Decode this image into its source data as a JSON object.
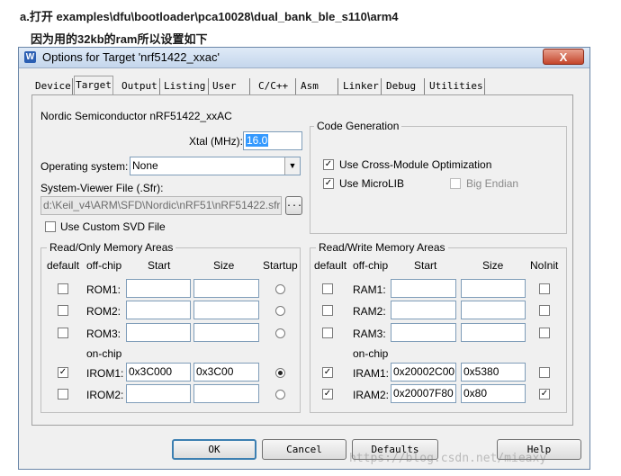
{
  "header": {
    "line1": "a.打开 examples\\dfu\\bootloader\\pca10028\\dual_bank_ble_s110\\arm4",
    "line2": "因为用的32kb的ram所以设置如下"
  },
  "dialog": {
    "icon": "W",
    "title": "Options for Target 'nrf51422_xxac'",
    "close": "X"
  },
  "tabs": [
    "Device",
    "Target",
    "Output",
    "Listing",
    "User",
    "C/C++",
    "Asm",
    "Linker",
    "Debug",
    "Utilities"
  ],
  "selected_tab": "Target",
  "target": {
    "device": "Nordic Semiconductor nRF51422_xxAC",
    "xtal_label": "Xtal (MHz):",
    "xtal_value": "16.0",
    "os_label": "Operating system:",
    "os_value": "None",
    "sv_label": "System-Viewer File (.Sfr):",
    "sv_value": "d:\\Keil_v4\\ARM\\SFD\\Nordic\\nRF51\\nRF51422.sfr",
    "browse": "...",
    "custom_svd": "Use Custom SVD File"
  },
  "codegen": {
    "title": "Code Generation",
    "cross_module": "Use Cross-Module Optimization",
    "microlib": "Use MicroLIB",
    "big_endian": "Big Endian"
  },
  "rom": {
    "title": "Read/Only Memory Areas",
    "col_default": "default",
    "col_offchip": "off-chip",
    "col_start": "Start",
    "col_size": "Size",
    "col_startup": "Startup",
    "onchip": "on-chip",
    "rows": [
      {
        "name": "ROM1:",
        "start": "",
        "size": ""
      },
      {
        "name": "ROM2:",
        "start": "",
        "size": ""
      },
      {
        "name": "ROM3:",
        "start": "",
        "size": ""
      },
      {
        "name": "IROM1:",
        "start": "0x3C000",
        "size": "0x3C00"
      },
      {
        "name": "IROM2:",
        "start": "",
        "size": ""
      }
    ]
  },
  "ram": {
    "title": "Read/Write Memory Areas",
    "col_default": "default",
    "col_offchip": "off-chip",
    "col_start": "Start",
    "col_size": "Size",
    "col_noinit": "NoInit",
    "onchip": "on-chip",
    "rows": [
      {
        "name": "RAM1:",
        "start": "",
        "size": ""
      },
      {
        "name": "RAM2:",
        "start": "",
        "size": ""
      },
      {
        "name": "RAM3:",
        "start": "",
        "size": ""
      },
      {
        "name": "IRAM1:",
        "start": "0x20002C00",
        "size": "0x5380"
      },
      {
        "name": "IRAM2:",
        "start": "0x20007F80",
        "size": "0x80"
      }
    ]
  },
  "buttons": {
    "ok": "OK",
    "cancel": "Cancel",
    "defaults": "Defaults",
    "help": "Help"
  },
  "watermark": "https://blog.csdn.net/mieaxy",
  "check": "✓"
}
